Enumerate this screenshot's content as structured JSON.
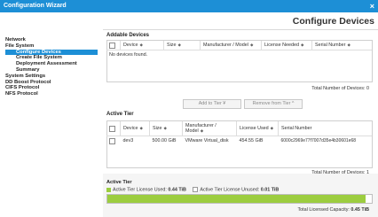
{
  "window": {
    "title": "Configuration Wizard",
    "close_glyph": "×"
  },
  "page_title": "Configure Devices",
  "sidebar": {
    "items": [
      {
        "label": "Network",
        "level": 0,
        "selected": false
      },
      {
        "label": "File System",
        "level": 0,
        "selected": false
      },
      {
        "label": "Configure Devices",
        "level": 1,
        "selected": true
      },
      {
        "label": "Create File System",
        "level": 1,
        "selected": false
      },
      {
        "label": "Deployment Assessment",
        "level": 1,
        "selected": false
      },
      {
        "label": "Summary",
        "level": 1,
        "selected": false
      },
      {
        "label": "System Settings",
        "level": 0,
        "selected": false
      },
      {
        "label": "DD Boost Protocol",
        "level": 0,
        "selected": false
      },
      {
        "label": "CIFS Protocol",
        "level": 0,
        "selected": false
      },
      {
        "label": "NFS Protocol",
        "level": 0,
        "selected": false
      }
    ]
  },
  "addable": {
    "title": "Addable Devices",
    "columns": [
      "Device",
      "Size",
      "Manufacturer / Model",
      "License Needed",
      "Serial Number"
    ],
    "empty_text": "No devices found.",
    "total_label": "Total Number of Devices: 0"
  },
  "buttons": {
    "add_to_tier": "Add to Tier",
    "remove_from_tier": "Remove from Tier"
  },
  "active_tier": {
    "title": "Active Tier",
    "columns": [
      "Device",
      "Size",
      "Manufacturer / Model",
      "License Used",
      "Serial Number"
    ],
    "rows": [
      {
        "device": "dev3",
        "size": "500.00 GiB",
        "model": "VMware Virtual_disk",
        "license": "454.55 GiB",
        "serial": "6000c2969e77f7007d35e4b30601e68"
      }
    ],
    "total_label": "Total Number of Devices: 1"
  },
  "usage": {
    "title": "Active Tier",
    "used_label": "Active Tier License Used:",
    "used_value": "0.44 TiB",
    "unused_label": "Active Tier License Unused:",
    "unused_value": "0.01 TiB",
    "used_fraction": 0.978,
    "capacity_label": "Total Licensed Capacity:",
    "capacity_value": "0.45 TiB",
    "colors": {
      "used": "#9ccd3f",
      "unused": "#ffffff",
      "titlebar": "#1d8fd6"
    }
  }
}
